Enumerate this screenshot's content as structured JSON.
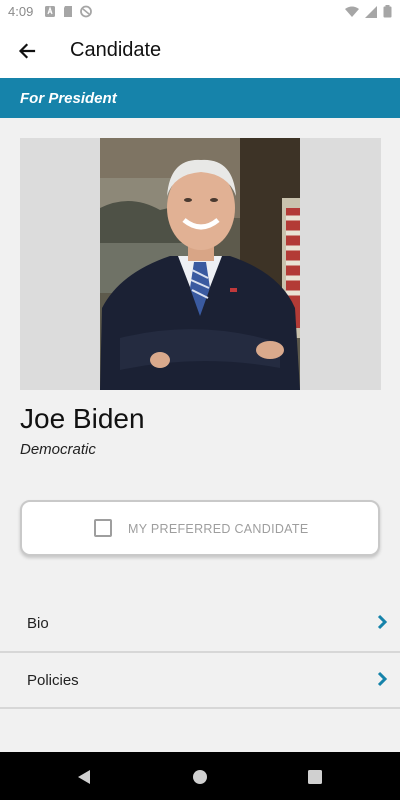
{
  "status_bar": {
    "time": "4:09"
  },
  "app_bar": {
    "title": "Candidate"
  },
  "race": {
    "label": "For President"
  },
  "candidate": {
    "name": "Joe Biden",
    "party": "Democratic"
  },
  "preferred": {
    "label": "MY PREFERRED CANDIDATE",
    "checked": false
  },
  "sections": [
    {
      "label": "Bio"
    },
    {
      "label": "Policies"
    }
  ],
  "colors": {
    "accent": "#1683aa",
    "background": "#f1f1f1"
  }
}
